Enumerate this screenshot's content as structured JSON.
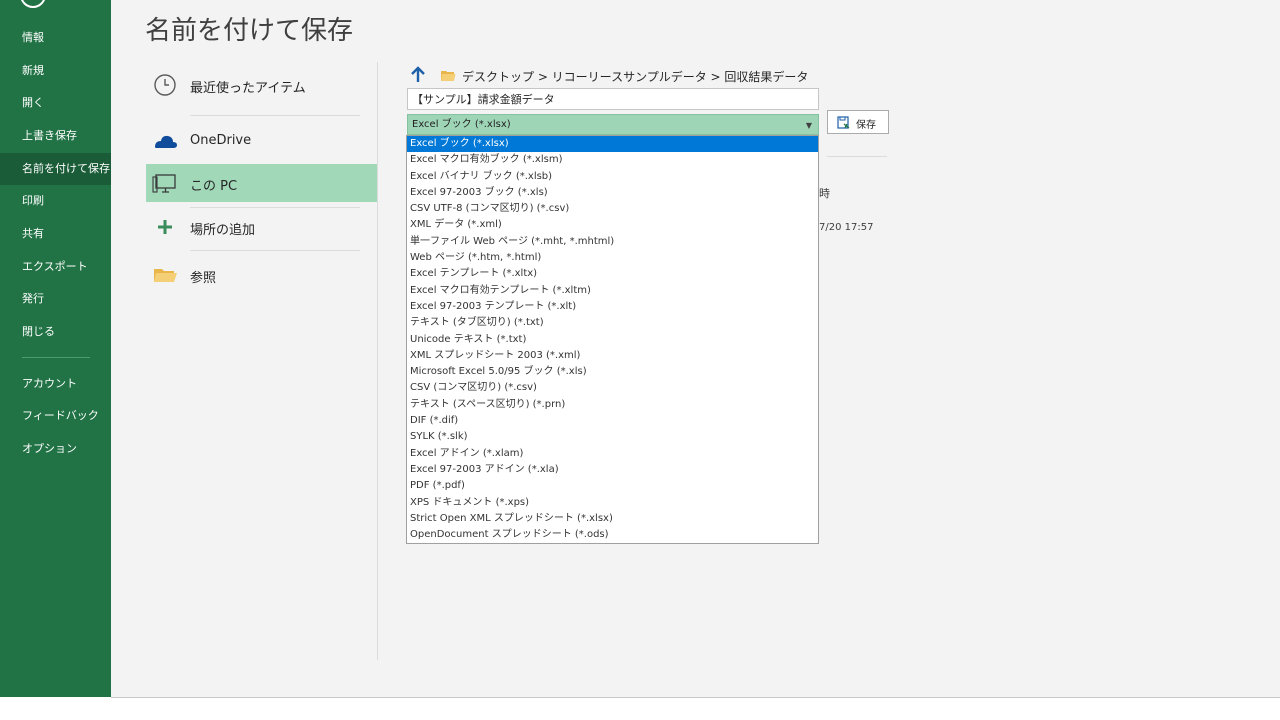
{
  "nav": {
    "items": [
      {
        "label": "情報"
      },
      {
        "label": "新規"
      },
      {
        "label": "開く"
      },
      {
        "label": "上書き保存"
      },
      {
        "label": "名前を付けて保存"
      },
      {
        "label": "印刷"
      },
      {
        "label": "共有"
      },
      {
        "label": "エクスポート"
      },
      {
        "label": "発行"
      },
      {
        "label": "閉じる"
      }
    ],
    "lower_items": [
      {
        "label": "アカウント"
      },
      {
        "label": "フィードバック"
      },
      {
        "label": "オプション"
      }
    ]
  },
  "page": {
    "title": "名前を付けて保存"
  },
  "locations": [
    {
      "label": "最近使ったアイテム",
      "icon": "clock-icon"
    },
    {
      "label": "OneDrive",
      "icon": "cloud-icon"
    },
    {
      "label": "この PC",
      "icon": "computer-icon"
    },
    {
      "label": "場所の追加",
      "icon": "plus-icon"
    },
    {
      "label": "参照",
      "icon": "folder-icon"
    }
  ],
  "path": {
    "breadcrumb": "デスクトップ > リコーリースサンプルデータ > 回収結果データ"
  },
  "filename": {
    "value": "【サンプル】請求金額データ"
  },
  "filetype": {
    "selected": "Excel ブック (*.xlsx)"
  },
  "save_button": {
    "label": "保存"
  },
  "file_list": {
    "header_fragment": "時",
    "date_fragment": "7/20 17:57"
  },
  "type_options": [
    "Excel ブック (*.xlsx)",
    "Excel マクロ有効ブック (*.xlsm)",
    "Excel バイナリ ブック (*.xlsb)",
    "Excel 97-2003 ブック (*.xls)",
    "CSV UTF-8 (コンマ区切り) (*.csv)",
    "XML データ (*.xml)",
    "単一ファイル Web ページ (*.mht, *.mhtml)",
    "Web ページ (*.htm, *.html)",
    "Excel テンプレート (*.xltx)",
    "Excel マクロ有効テンプレート (*.xltm)",
    "Excel 97-2003 テンプレート (*.xlt)",
    "テキスト (タブ区切り) (*.txt)",
    "Unicode テキスト (*.txt)",
    "XML スプレッドシート 2003 (*.xml)",
    "Microsoft Excel 5.0/95 ブック (*.xls)",
    "CSV (コンマ区切り) (*.csv)",
    "テキスト (スペース区切り) (*.prn)",
    "DIF (*.dif)",
    "SYLK (*.slk)",
    "Excel アドイン (*.xlam)",
    "Excel 97-2003 アドイン (*.xla)",
    "PDF (*.pdf)",
    "XPS ドキュメント (*.xps)",
    "Strict Open XML スプレッドシート (*.xlsx)",
    "OpenDocument スプレッドシート (*.ods)"
  ],
  "colors": {
    "nav_bg": "#217346",
    "selection_blue": "#0078d7",
    "select_green": "#9fd5b7"
  }
}
